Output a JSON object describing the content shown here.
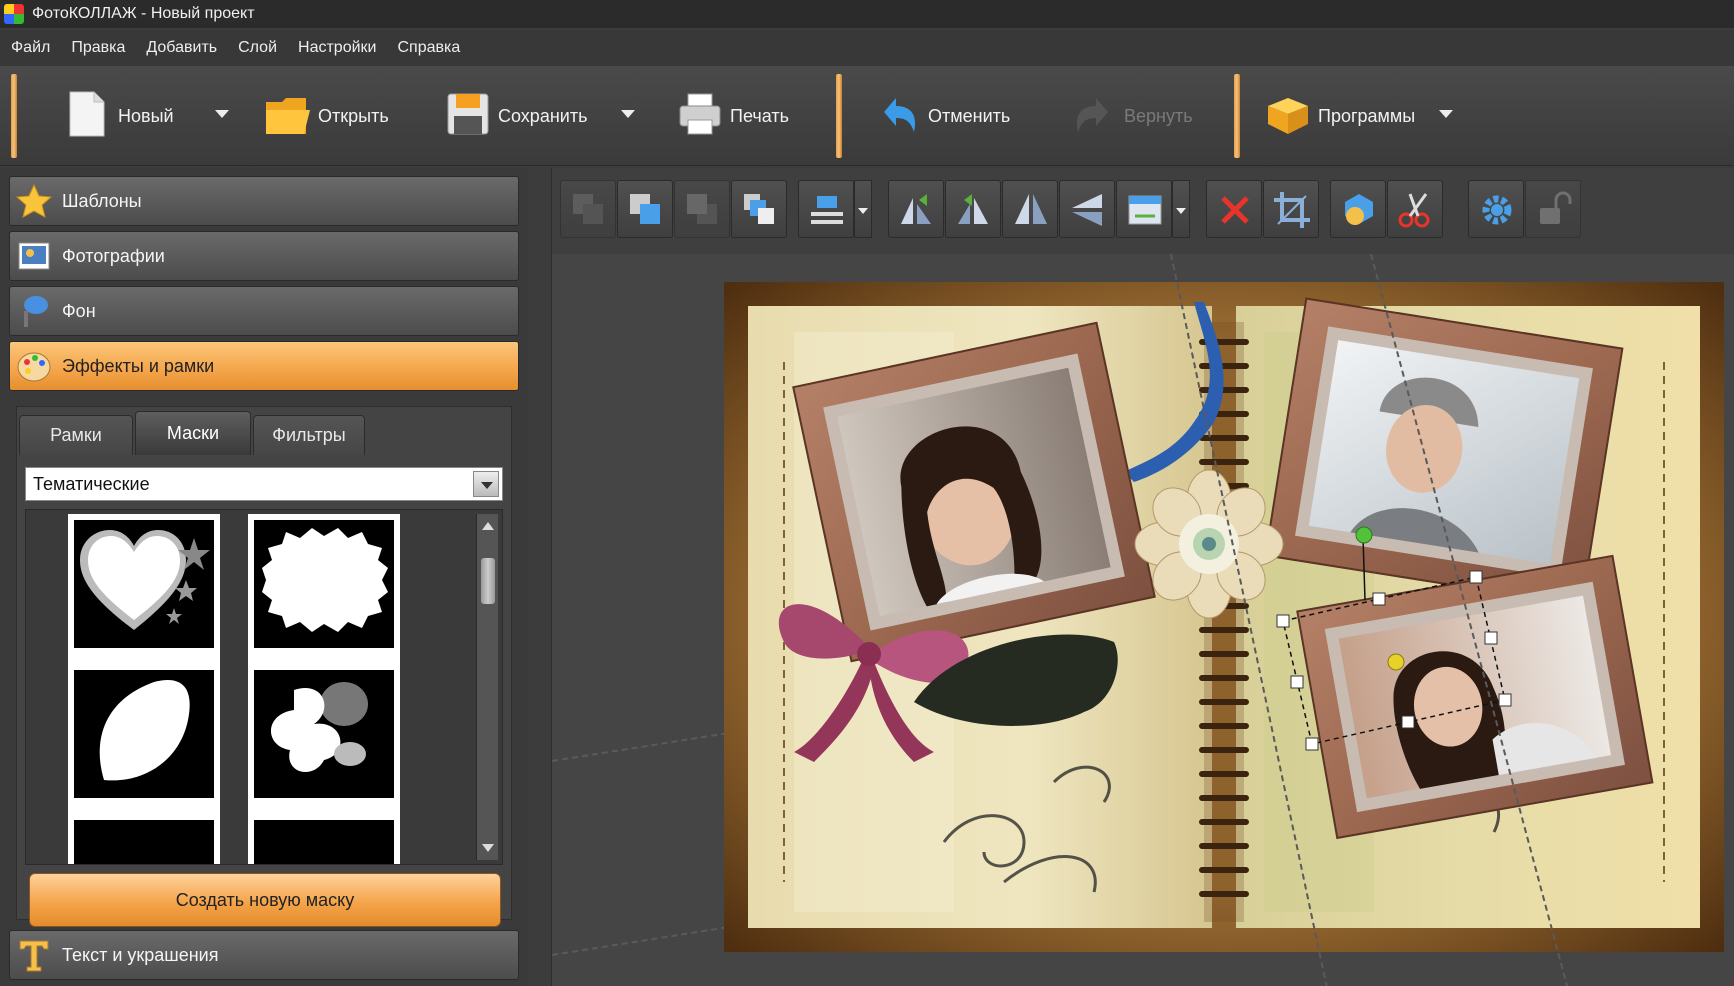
{
  "window": {
    "title": "ФотоКОЛЛАЖ - Новый проект"
  },
  "menu": [
    "Файл",
    "Правка",
    "Добавить",
    "Слой",
    "Настройки",
    "Справка"
  ],
  "toolbar": {
    "new": "Новый",
    "open": "Открыть",
    "save": "Сохранить",
    "print": "Печать",
    "undo": "Отменить",
    "redo": "Вернуть",
    "programs": "Программы"
  },
  "panel": {
    "sections": {
      "templates": "Шаблоны",
      "photos": "Фотографии",
      "background": "Фон",
      "effects": "Эффекты и рамки",
      "text": "Текст и украшения"
    },
    "tabs": {
      "frames": "Рамки",
      "masks": "Маски",
      "filters": "Фильтры"
    },
    "category": "Тематические",
    "create_mask": "Создать новую маску"
  },
  "colors": {
    "accent": "#f4a44a",
    "panel": "#3a3a3a",
    "selection_handle": "#53c13a"
  }
}
